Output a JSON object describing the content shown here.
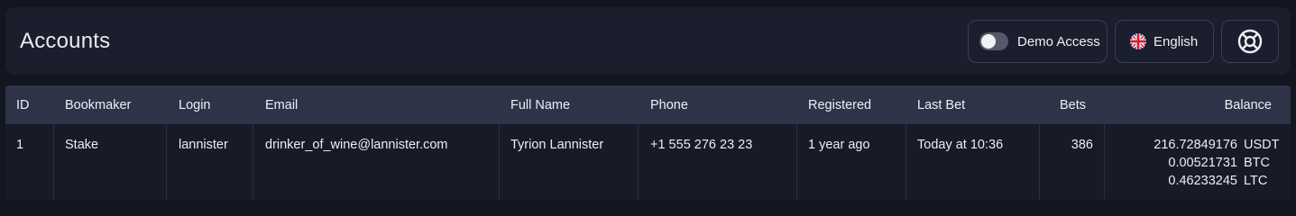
{
  "header": {
    "title": "Accounts",
    "demo_label": "Demo Access",
    "demo_enabled": false,
    "language_label": "English"
  },
  "table": {
    "columns": [
      "ID",
      "Bookmaker",
      "Login",
      "Email",
      "Full Name",
      "Phone",
      "Registered",
      "Last Bet",
      "Bets",
      "Balance"
    ],
    "rows": [
      {
        "id": "1",
        "bookmaker": "Stake",
        "login": "lannister",
        "email": "drinker_of_wine@lannister.com",
        "full_name": "Tyrion Lannister",
        "phone": "+1 555 276 23 23",
        "registered": "1 year ago",
        "last_bet": "Today at 10:36",
        "bets": "386",
        "balance": [
          {
            "amount": "216.72849176",
            "currency": "USDT"
          },
          {
            "amount": "0.00521731",
            "currency": "BTC"
          },
          {
            "amount": "0.46233245",
            "currency": "LTC"
          }
        ]
      }
    ]
  },
  "colors": {
    "page_bg": "#131521",
    "panel_bg": "#1b1e2c",
    "table_header_bg": "#2e3347",
    "row_bg": "#171a27"
  },
  "icons": {
    "language": "uk-flag-icon",
    "help": "lifebuoy-icon"
  }
}
